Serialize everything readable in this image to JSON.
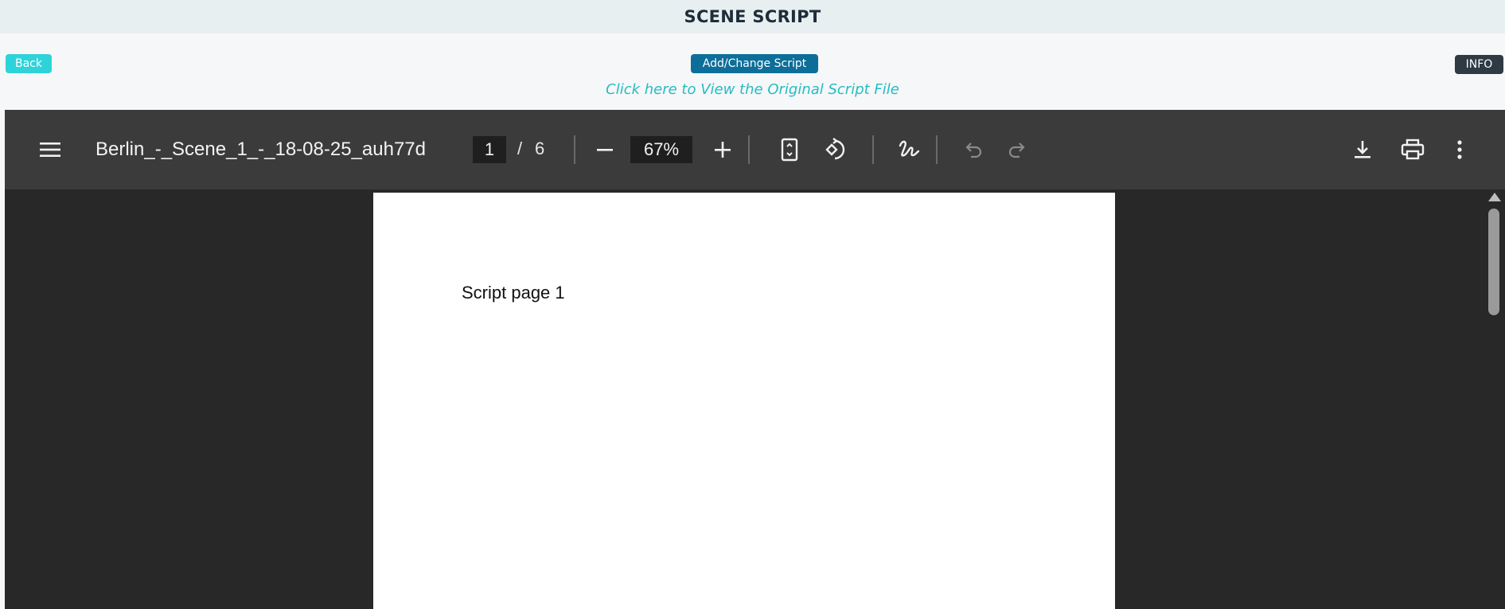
{
  "header": {
    "title": "SCENE SCRIPT"
  },
  "actions": {
    "back_label": "Back",
    "change_script_label": "Add/Change Script",
    "info_label": "INFO",
    "view_original_link": "Click here to View the Original Script File"
  },
  "pdf_viewer": {
    "document_title": "Berlin_-_Scene_1_-_18-08-25_auh77d",
    "current_page": "1",
    "page_separator": "/",
    "total_pages": "6",
    "zoom": "67%",
    "page_content": "Script page 1",
    "toolbar_icons": [
      "menu-icon",
      "zoom-out-icon",
      "zoom-in-icon",
      "fit-page-icon",
      "rotate-icon",
      "annotate-icon",
      "undo-icon",
      "redo-icon",
      "download-icon",
      "print-icon",
      "more-icon"
    ]
  },
  "colors": {
    "back_button": "#2ed3da",
    "change_button": "#0d6e99",
    "info_button": "#2e3a44",
    "link": "#25bcc4",
    "viewer_toolbar": "#3b3b3b",
    "viewer_background": "#282828"
  }
}
